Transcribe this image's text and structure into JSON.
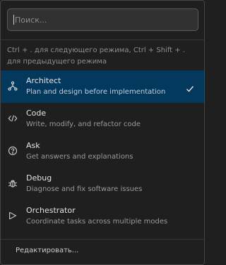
{
  "search": {
    "placeholder": "Поиск..."
  },
  "hint": "Ctrl + . для следующего режима, Ctrl + Shift + . для предыдущего режима",
  "modes": [
    {
      "title": "Architect",
      "description": "Plan and design before implementation",
      "icon": "architect-icon",
      "selected": true
    },
    {
      "title": "Code",
      "description": "Write, modify, and refactor code",
      "icon": "code-icon",
      "selected": false
    },
    {
      "title": "Ask",
      "description": "Get answers and explanations",
      "icon": "question-icon",
      "selected": false
    },
    {
      "title": "Debug",
      "description": "Diagnose and fix software issues",
      "icon": "bug-icon",
      "selected": false
    },
    {
      "title": "Orchestrator",
      "description": "Coordinate tasks across multiple modes",
      "icon": "run-icon",
      "selected": false
    }
  ],
  "footer": {
    "edit_label": "Редактировать..."
  },
  "colors": {
    "selected_bg": "#04395e",
    "panel_bg": "#1f1f1f",
    "input_bg": "#313131"
  }
}
